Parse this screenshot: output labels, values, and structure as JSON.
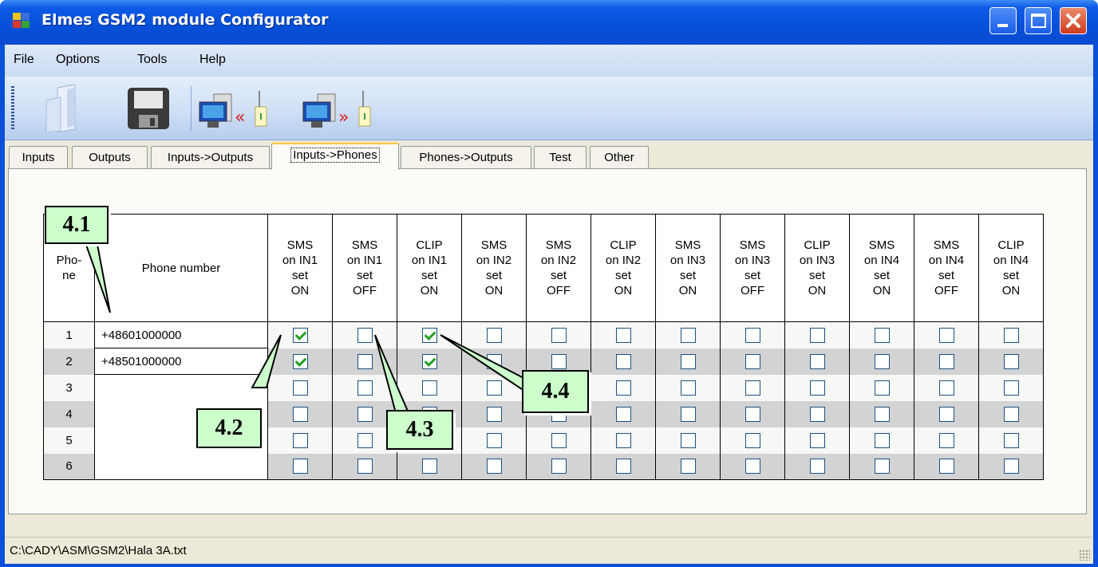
{
  "window": {
    "title": "Elmes GSM2 module Configurator"
  },
  "menu": [
    "File",
    "Options",
    "Tools",
    "Help"
  ],
  "toolbar": {
    "buttons": [
      {
        "name": "open-button",
        "icon": "open-file-icon"
      },
      {
        "name": "save-button",
        "icon": "floppy-disk-icon"
      },
      {
        "name": "read-from-module-button",
        "icon": "computer-read-icon"
      },
      {
        "name": "write-to-module-button",
        "icon": "computer-write-icon"
      }
    ]
  },
  "tabs": [
    "Inputs",
    "Outputs",
    "Inputs->Outputs",
    "Inputs->Phones",
    "Phones->Outputs",
    "Test",
    "Other"
  ],
  "active_tab": "Inputs->Phones",
  "grid": {
    "header_phone_no": [
      "Pho-",
      "ne"
    ],
    "header_phone_number": "Phone number",
    "columns": [
      [
        "SMS",
        "on IN1",
        "set",
        "ON"
      ],
      [
        "SMS",
        "on IN1",
        "set",
        "OFF"
      ],
      [
        "CLIP",
        "on IN1",
        "set",
        "ON"
      ],
      [
        "SMS",
        "on IN2",
        "set",
        "ON"
      ],
      [
        "SMS",
        "on IN2",
        "set",
        "OFF"
      ],
      [
        "CLIP",
        "on IN2",
        "set",
        "ON"
      ],
      [
        "SMS",
        "on IN3",
        "set",
        "ON"
      ],
      [
        "SMS",
        "on IN3",
        "set",
        "OFF"
      ],
      [
        "CLIP",
        "on IN3",
        "set",
        "ON"
      ],
      [
        "SMS",
        "on IN4",
        "set",
        "ON"
      ],
      [
        "SMS",
        "on IN4",
        "set",
        "OFF"
      ],
      [
        "CLIP",
        "on IN4",
        "set",
        "ON"
      ]
    ],
    "rows": [
      {
        "no": "1",
        "phone": "+48601000000",
        "checks": [
          true,
          false,
          true,
          false,
          false,
          false,
          false,
          false,
          false,
          false,
          false,
          false
        ]
      },
      {
        "no": "2",
        "phone": "+48501000000",
        "checks": [
          true,
          false,
          true,
          false,
          false,
          false,
          false,
          false,
          false,
          false,
          false,
          false
        ]
      },
      {
        "no": "3",
        "phone": "",
        "checks": [
          false,
          false,
          false,
          false,
          false,
          false,
          false,
          false,
          false,
          false,
          false,
          false
        ]
      },
      {
        "no": "4",
        "phone": "",
        "checks": [
          false,
          false,
          false,
          false,
          false,
          false,
          false,
          false,
          false,
          false,
          false,
          false
        ]
      },
      {
        "no": "5",
        "phone": "",
        "checks": [
          false,
          false,
          false,
          false,
          false,
          false,
          false,
          false,
          false,
          false,
          false,
          false
        ]
      },
      {
        "no": "6",
        "phone": "",
        "checks": [
          false,
          false,
          false,
          false,
          false,
          false,
          false,
          false,
          false,
          false,
          false,
          false
        ]
      }
    ]
  },
  "callouts": [
    "4.1",
    "4.2",
    "4.3",
    "4.4"
  ],
  "status": {
    "path": "C:\\CADY\\ASM\\GSM2\\Hala 3A.txt"
  },
  "colors": {
    "titlebar": "#0550d8",
    "callout_fill": "#ccffcc",
    "check": "#21a121",
    "alt_row": "#d3d3d3"
  }
}
